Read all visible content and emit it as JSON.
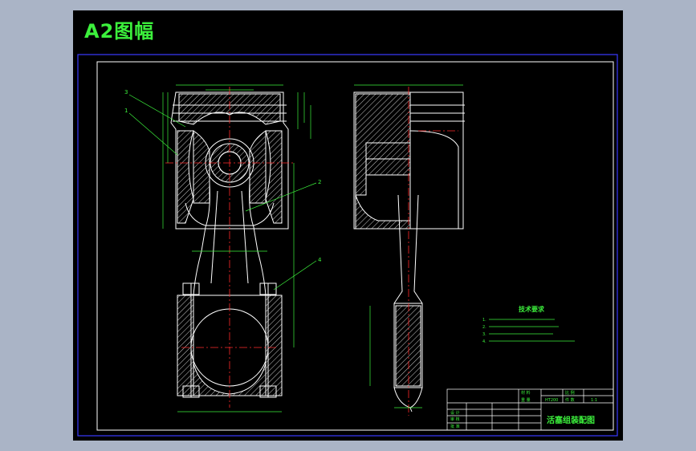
{
  "sheet": {
    "title": "A2图幅"
  },
  "colors": {
    "background": "#aab4c6",
    "sheet": "#000000",
    "frame": "#3a3aff",
    "border": "#ffffff",
    "geometry": "#ffffff",
    "centerline": "#ff2a2a",
    "dimension": "#3cf03c",
    "title": "#3cf03c",
    "hatch": "#ffffff"
  },
  "callouts": [
    "3",
    "1",
    "2",
    "4"
  ],
  "technical_requirements": {
    "heading": "技术要求",
    "items": [
      "1. ",
      "2. ",
      "3. ",
      "4. "
    ]
  },
  "title_block": {
    "cells": {
      "label_material": "材 料",
      "value_material": "HT200",
      "label_scale": "比 例",
      "value_scale": "1:1",
      "label_weight": "重 量",
      "label_count": "件 数",
      "label_drawn": "设 计",
      "label_checked": "审 核",
      "label_approved": "批 准",
      "drawing_name": "活塞组装配图"
    }
  }
}
